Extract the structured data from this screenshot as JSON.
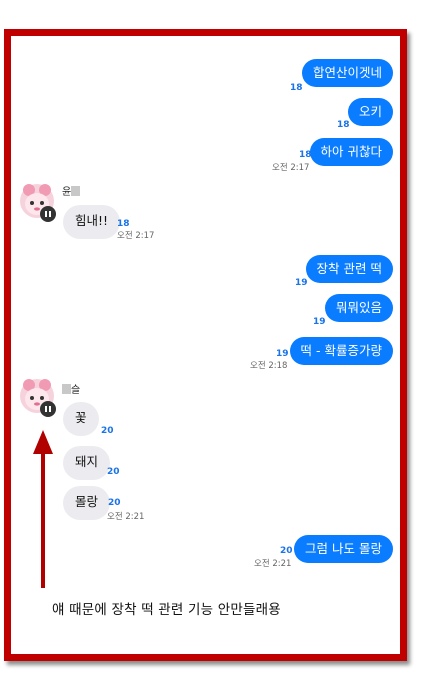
{
  "chat": {
    "outgoing_1": {
      "text": "합연산이겟네",
      "count": "18"
    },
    "outgoing_2": {
      "text": "오키",
      "count": "18"
    },
    "outgoing_3": {
      "text": "하아 귀찮다",
      "count": "18",
      "time": "오전 2:17"
    },
    "sender_1": {
      "name_visible": "윤",
      "icon": "avatar-pink-character"
    },
    "incoming_1": {
      "text": "힘내!!",
      "count": "18",
      "time": "오전 2:17"
    },
    "outgoing_4": {
      "text": "장착 관련 떡",
      "count": "19"
    },
    "outgoing_5": {
      "text": "뭐뭐있음",
      "count": "19"
    },
    "outgoing_6": {
      "text": "떡 - 확률증가량",
      "count": "19",
      "time": "오전 2:18"
    },
    "sender_2": {
      "name_visible": "슬",
      "icon": "avatar-pink-character"
    },
    "incoming_2": {
      "text": "꽃",
      "count": "20"
    },
    "incoming_3": {
      "text": "돼지",
      "count": "20"
    },
    "incoming_4": {
      "text": "몰랑",
      "count": "20",
      "time": "오전 2:21"
    },
    "outgoing_7": {
      "text": "그럼 나도 몰랑",
      "count": "20",
      "time": "오전 2:21"
    }
  },
  "annotation": {
    "caption": "얘 때문에 장착 떡 관련 기능 안만들래용",
    "arrow_color": "#b00000",
    "frame_color": "#c00000"
  },
  "colors": {
    "outgoing_bubble": "#0a7cff",
    "incoming_bubble": "#ececf0",
    "read_count": "#1a73e8"
  }
}
